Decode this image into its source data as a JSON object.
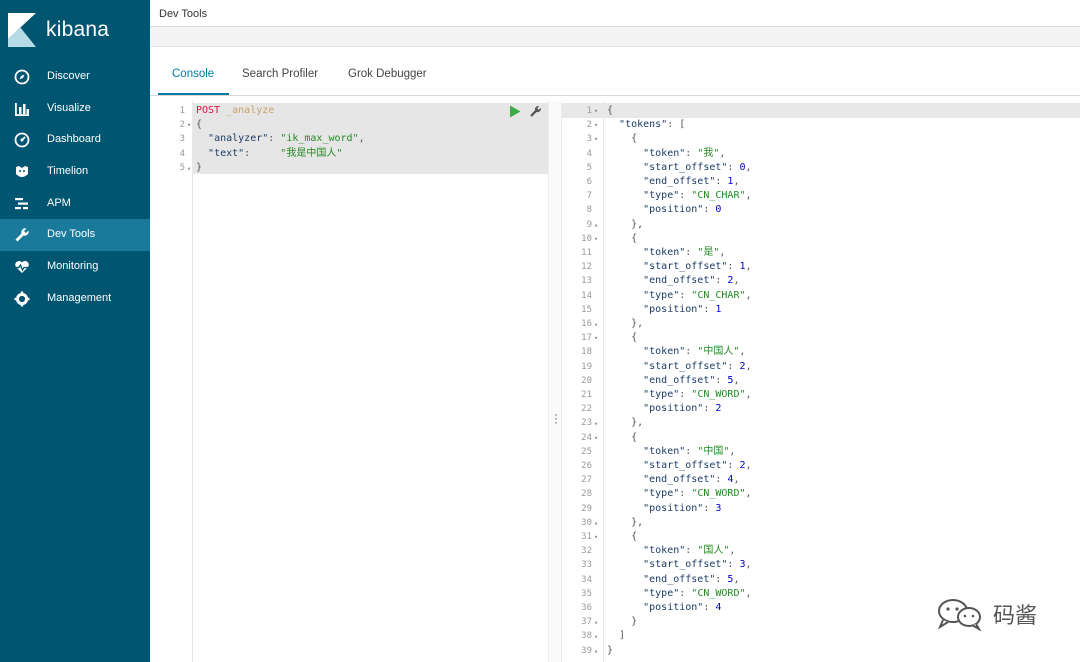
{
  "brand": {
    "name": "kibana"
  },
  "sidebar": {
    "items": [
      {
        "label": "Discover",
        "icon": "compass-icon",
        "active": false
      },
      {
        "label": "Visualize",
        "icon": "bar-chart-icon",
        "active": false
      },
      {
        "label": "Dashboard",
        "icon": "dashboard-icon",
        "active": false
      },
      {
        "label": "Timelion",
        "icon": "timelion-icon",
        "active": false
      },
      {
        "label": "APM",
        "icon": "apm-icon",
        "active": false
      },
      {
        "label": "Dev Tools",
        "icon": "wrench-icon",
        "active": true
      },
      {
        "label": "Monitoring",
        "icon": "heartbeat-icon",
        "active": false
      },
      {
        "label": "Management",
        "icon": "gear-icon",
        "active": false
      }
    ]
  },
  "header": {
    "title": "Dev Tools"
  },
  "tabs": [
    {
      "label": "Console",
      "active": true
    },
    {
      "label": "Search Profiler",
      "active": false
    },
    {
      "label": "Grok Debugger",
      "active": false
    }
  ],
  "request": {
    "lines": [
      {
        "n": "1",
        "fold": "",
        "parts": [
          [
            "c-method",
            "POST"
          ],
          [
            "c-punc",
            " "
          ],
          [
            "c-url",
            "_analyze"
          ]
        ]
      },
      {
        "n": "2",
        "fold": "▾",
        "parts": [
          [
            "c-punc",
            "{"
          ]
        ]
      },
      {
        "n": "3",
        "fold": "",
        "parts": [
          [
            "c-punc",
            "  "
          ],
          [
            "c-key",
            "\"analyzer\""
          ],
          [
            "c-punc",
            ": "
          ],
          [
            "c-str",
            "\"ik_max_word\""
          ],
          [
            "c-punc",
            ","
          ]
        ]
      },
      {
        "n": "4",
        "fold": "",
        "parts": [
          [
            "c-punc",
            "  "
          ],
          [
            "c-key",
            "\"text\""
          ],
          [
            "c-punc",
            ":     "
          ],
          [
            "c-str",
            "\"我是中国人\""
          ]
        ]
      },
      {
        "n": "5",
        "fold": "▴",
        "parts": [
          [
            "c-punc",
            "}"
          ]
        ]
      }
    ]
  },
  "response": {
    "lines": [
      {
        "n": "1",
        "fold": "▾",
        "parts": [
          [
            "c-punc",
            "{"
          ]
        ]
      },
      {
        "n": "2",
        "fold": "▾",
        "parts": [
          [
            "c-punc",
            "  "
          ],
          [
            "c-key",
            "\"tokens\""
          ],
          [
            "c-punc",
            ": ["
          ]
        ]
      },
      {
        "n": "3",
        "fold": "▾",
        "parts": [
          [
            "c-punc",
            "    {"
          ]
        ]
      },
      {
        "n": "4",
        "fold": "",
        "parts": [
          [
            "c-punc",
            "      "
          ],
          [
            "c-key",
            "\"token\""
          ],
          [
            "c-punc",
            ": "
          ],
          [
            "c-str",
            "\"我\""
          ],
          [
            "c-punc",
            ","
          ]
        ]
      },
      {
        "n": "5",
        "fold": "",
        "parts": [
          [
            "c-punc",
            "      "
          ],
          [
            "c-key",
            "\"start_offset\""
          ],
          [
            "c-punc",
            ": "
          ],
          [
            "c-num",
            "0"
          ],
          [
            "c-punc",
            ","
          ]
        ]
      },
      {
        "n": "6",
        "fold": "",
        "parts": [
          [
            "c-punc",
            "      "
          ],
          [
            "c-key",
            "\"end_offset\""
          ],
          [
            "c-punc",
            ": "
          ],
          [
            "c-num",
            "1"
          ],
          [
            "c-punc",
            ","
          ]
        ]
      },
      {
        "n": "7",
        "fold": "",
        "parts": [
          [
            "c-punc",
            "      "
          ],
          [
            "c-key",
            "\"type\""
          ],
          [
            "c-punc",
            ": "
          ],
          [
            "c-str",
            "\"CN_CHAR\""
          ],
          [
            "c-punc",
            ","
          ]
        ]
      },
      {
        "n": "8",
        "fold": "",
        "parts": [
          [
            "c-punc",
            "      "
          ],
          [
            "c-key",
            "\"position\""
          ],
          [
            "c-punc",
            ": "
          ],
          [
            "c-num",
            "0"
          ]
        ]
      },
      {
        "n": "9",
        "fold": "▴",
        "parts": [
          [
            "c-punc",
            "    },"
          ]
        ]
      },
      {
        "n": "10",
        "fold": "▾",
        "parts": [
          [
            "c-punc",
            "    {"
          ]
        ]
      },
      {
        "n": "11",
        "fold": "",
        "parts": [
          [
            "c-punc",
            "      "
          ],
          [
            "c-key",
            "\"token\""
          ],
          [
            "c-punc",
            ": "
          ],
          [
            "c-str",
            "\"是\""
          ],
          [
            "c-punc",
            ","
          ]
        ]
      },
      {
        "n": "12",
        "fold": "",
        "parts": [
          [
            "c-punc",
            "      "
          ],
          [
            "c-key",
            "\"start_offset\""
          ],
          [
            "c-punc",
            ": "
          ],
          [
            "c-num",
            "1"
          ],
          [
            "c-punc",
            ","
          ]
        ]
      },
      {
        "n": "13",
        "fold": "",
        "parts": [
          [
            "c-punc",
            "      "
          ],
          [
            "c-key",
            "\"end_offset\""
          ],
          [
            "c-punc",
            ": "
          ],
          [
            "c-num",
            "2"
          ],
          [
            "c-punc",
            ","
          ]
        ]
      },
      {
        "n": "14",
        "fold": "",
        "parts": [
          [
            "c-punc",
            "      "
          ],
          [
            "c-key",
            "\"type\""
          ],
          [
            "c-punc",
            ": "
          ],
          [
            "c-str",
            "\"CN_CHAR\""
          ],
          [
            "c-punc",
            ","
          ]
        ]
      },
      {
        "n": "15",
        "fold": "",
        "parts": [
          [
            "c-punc",
            "      "
          ],
          [
            "c-key",
            "\"position\""
          ],
          [
            "c-punc",
            ": "
          ],
          [
            "c-num",
            "1"
          ]
        ]
      },
      {
        "n": "16",
        "fold": "▴",
        "parts": [
          [
            "c-punc",
            "    },"
          ]
        ]
      },
      {
        "n": "17",
        "fold": "▾",
        "parts": [
          [
            "c-punc",
            "    {"
          ]
        ]
      },
      {
        "n": "18",
        "fold": "",
        "parts": [
          [
            "c-punc",
            "      "
          ],
          [
            "c-key",
            "\"token\""
          ],
          [
            "c-punc",
            ": "
          ],
          [
            "c-str",
            "\"中国人\""
          ],
          [
            "c-punc",
            ","
          ]
        ]
      },
      {
        "n": "19",
        "fold": "",
        "parts": [
          [
            "c-punc",
            "      "
          ],
          [
            "c-key",
            "\"start_offset\""
          ],
          [
            "c-punc",
            ": "
          ],
          [
            "c-num",
            "2"
          ],
          [
            "c-punc",
            ","
          ]
        ]
      },
      {
        "n": "20",
        "fold": "",
        "parts": [
          [
            "c-punc",
            "      "
          ],
          [
            "c-key",
            "\"end_offset\""
          ],
          [
            "c-punc",
            ": "
          ],
          [
            "c-num",
            "5"
          ],
          [
            "c-punc",
            ","
          ]
        ]
      },
      {
        "n": "21",
        "fold": "",
        "parts": [
          [
            "c-punc",
            "      "
          ],
          [
            "c-key",
            "\"type\""
          ],
          [
            "c-punc",
            ": "
          ],
          [
            "c-str",
            "\"CN_WORD\""
          ],
          [
            "c-punc",
            ","
          ]
        ]
      },
      {
        "n": "22",
        "fold": "",
        "parts": [
          [
            "c-punc",
            "      "
          ],
          [
            "c-key",
            "\"position\""
          ],
          [
            "c-punc",
            ": "
          ],
          [
            "c-num",
            "2"
          ]
        ]
      },
      {
        "n": "23",
        "fold": "▴",
        "parts": [
          [
            "c-punc",
            "    },"
          ]
        ]
      },
      {
        "n": "24",
        "fold": "▾",
        "parts": [
          [
            "c-punc",
            "    {"
          ]
        ]
      },
      {
        "n": "25",
        "fold": "",
        "parts": [
          [
            "c-punc",
            "      "
          ],
          [
            "c-key",
            "\"token\""
          ],
          [
            "c-punc",
            ": "
          ],
          [
            "c-str",
            "\"中国\""
          ],
          [
            "c-punc",
            ","
          ]
        ]
      },
      {
        "n": "26",
        "fold": "",
        "parts": [
          [
            "c-punc",
            "      "
          ],
          [
            "c-key",
            "\"start_offset\""
          ],
          [
            "c-punc",
            ": "
          ],
          [
            "c-num",
            "2"
          ],
          [
            "c-punc",
            ","
          ]
        ]
      },
      {
        "n": "27",
        "fold": "",
        "parts": [
          [
            "c-punc",
            "      "
          ],
          [
            "c-key",
            "\"end_offset\""
          ],
          [
            "c-punc",
            ": "
          ],
          [
            "c-num",
            "4"
          ],
          [
            "c-punc",
            ","
          ]
        ]
      },
      {
        "n": "28",
        "fold": "",
        "parts": [
          [
            "c-punc",
            "      "
          ],
          [
            "c-key",
            "\"type\""
          ],
          [
            "c-punc",
            ": "
          ],
          [
            "c-str",
            "\"CN_WORD\""
          ],
          [
            "c-punc",
            ","
          ]
        ]
      },
      {
        "n": "29",
        "fold": "",
        "parts": [
          [
            "c-punc",
            "      "
          ],
          [
            "c-key",
            "\"position\""
          ],
          [
            "c-punc",
            ": "
          ],
          [
            "c-num",
            "3"
          ]
        ]
      },
      {
        "n": "30",
        "fold": "▴",
        "parts": [
          [
            "c-punc",
            "    },"
          ]
        ]
      },
      {
        "n": "31",
        "fold": "▾",
        "parts": [
          [
            "c-punc",
            "    {"
          ]
        ]
      },
      {
        "n": "32",
        "fold": "",
        "parts": [
          [
            "c-punc",
            "      "
          ],
          [
            "c-key",
            "\"token\""
          ],
          [
            "c-punc",
            ": "
          ],
          [
            "c-str",
            "\"国人\""
          ],
          [
            "c-punc",
            ","
          ]
        ]
      },
      {
        "n": "33",
        "fold": "",
        "parts": [
          [
            "c-punc",
            "      "
          ],
          [
            "c-key",
            "\"start_offset\""
          ],
          [
            "c-punc",
            ": "
          ],
          [
            "c-num",
            "3"
          ],
          [
            "c-punc",
            ","
          ]
        ]
      },
      {
        "n": "34",
        "fold": "",
        "parts": [
          [
            "c-punc",
            "      "
          ],
          [
            "c-key",
            "\"end_offset\""
          ],
          [
            "c-punc",
            ": "
          ],
          [
            "c-num",
            "5"
          ],
          [
            "c-punc",
            ","
          ]
        ]
      },
      {
        "n": "35",
        "fold": "",
        "parts": [
          [
            "c-punc",
            "      "
          ],
          [
            "c-key",
            "\"type\""
          ],
          [
            "c-punc",
            ": "
          ],
          [
            "c-str",
            "\"CN_WORD\""
          ],
          [
            "c-punc",
            ","
          ]
        ]
      },
      {
        "n": "36",
        "fold": "",
        "parts": [
          [
            "c-punc",
            "      "
          ],
          [
            "c-key",
            "\"position\""
          ],
          [
            "c-punc",
            ": "
          ],
          [
            "c-num",
            "4"
          ]
        ]
      },
      {
        "n": "37",
        "fold": "▴",
        "parts": [
          [
            "c-punc",
            "    }"
          ]
        ]
      },
      {
        "n": "38",
        "fold": "▴",
        "parts": [
          [
            "c-punc",
            "  ]"
          ]
        ]
      },
      {
        "n": "39",
        "fold": "▴",
        "parts": [
          [
            "c-punc",
            "}"
          ]
        ]
      }
    ]
  },
  "watermark": {
    "text": "码酱"
  },
  "colors": {
    "sidebar": "#005571",
    "sidebar_active": "#1a7a9c",
    "accent": "#0079a5",
    "play": "#3cab4a"
  }
}
